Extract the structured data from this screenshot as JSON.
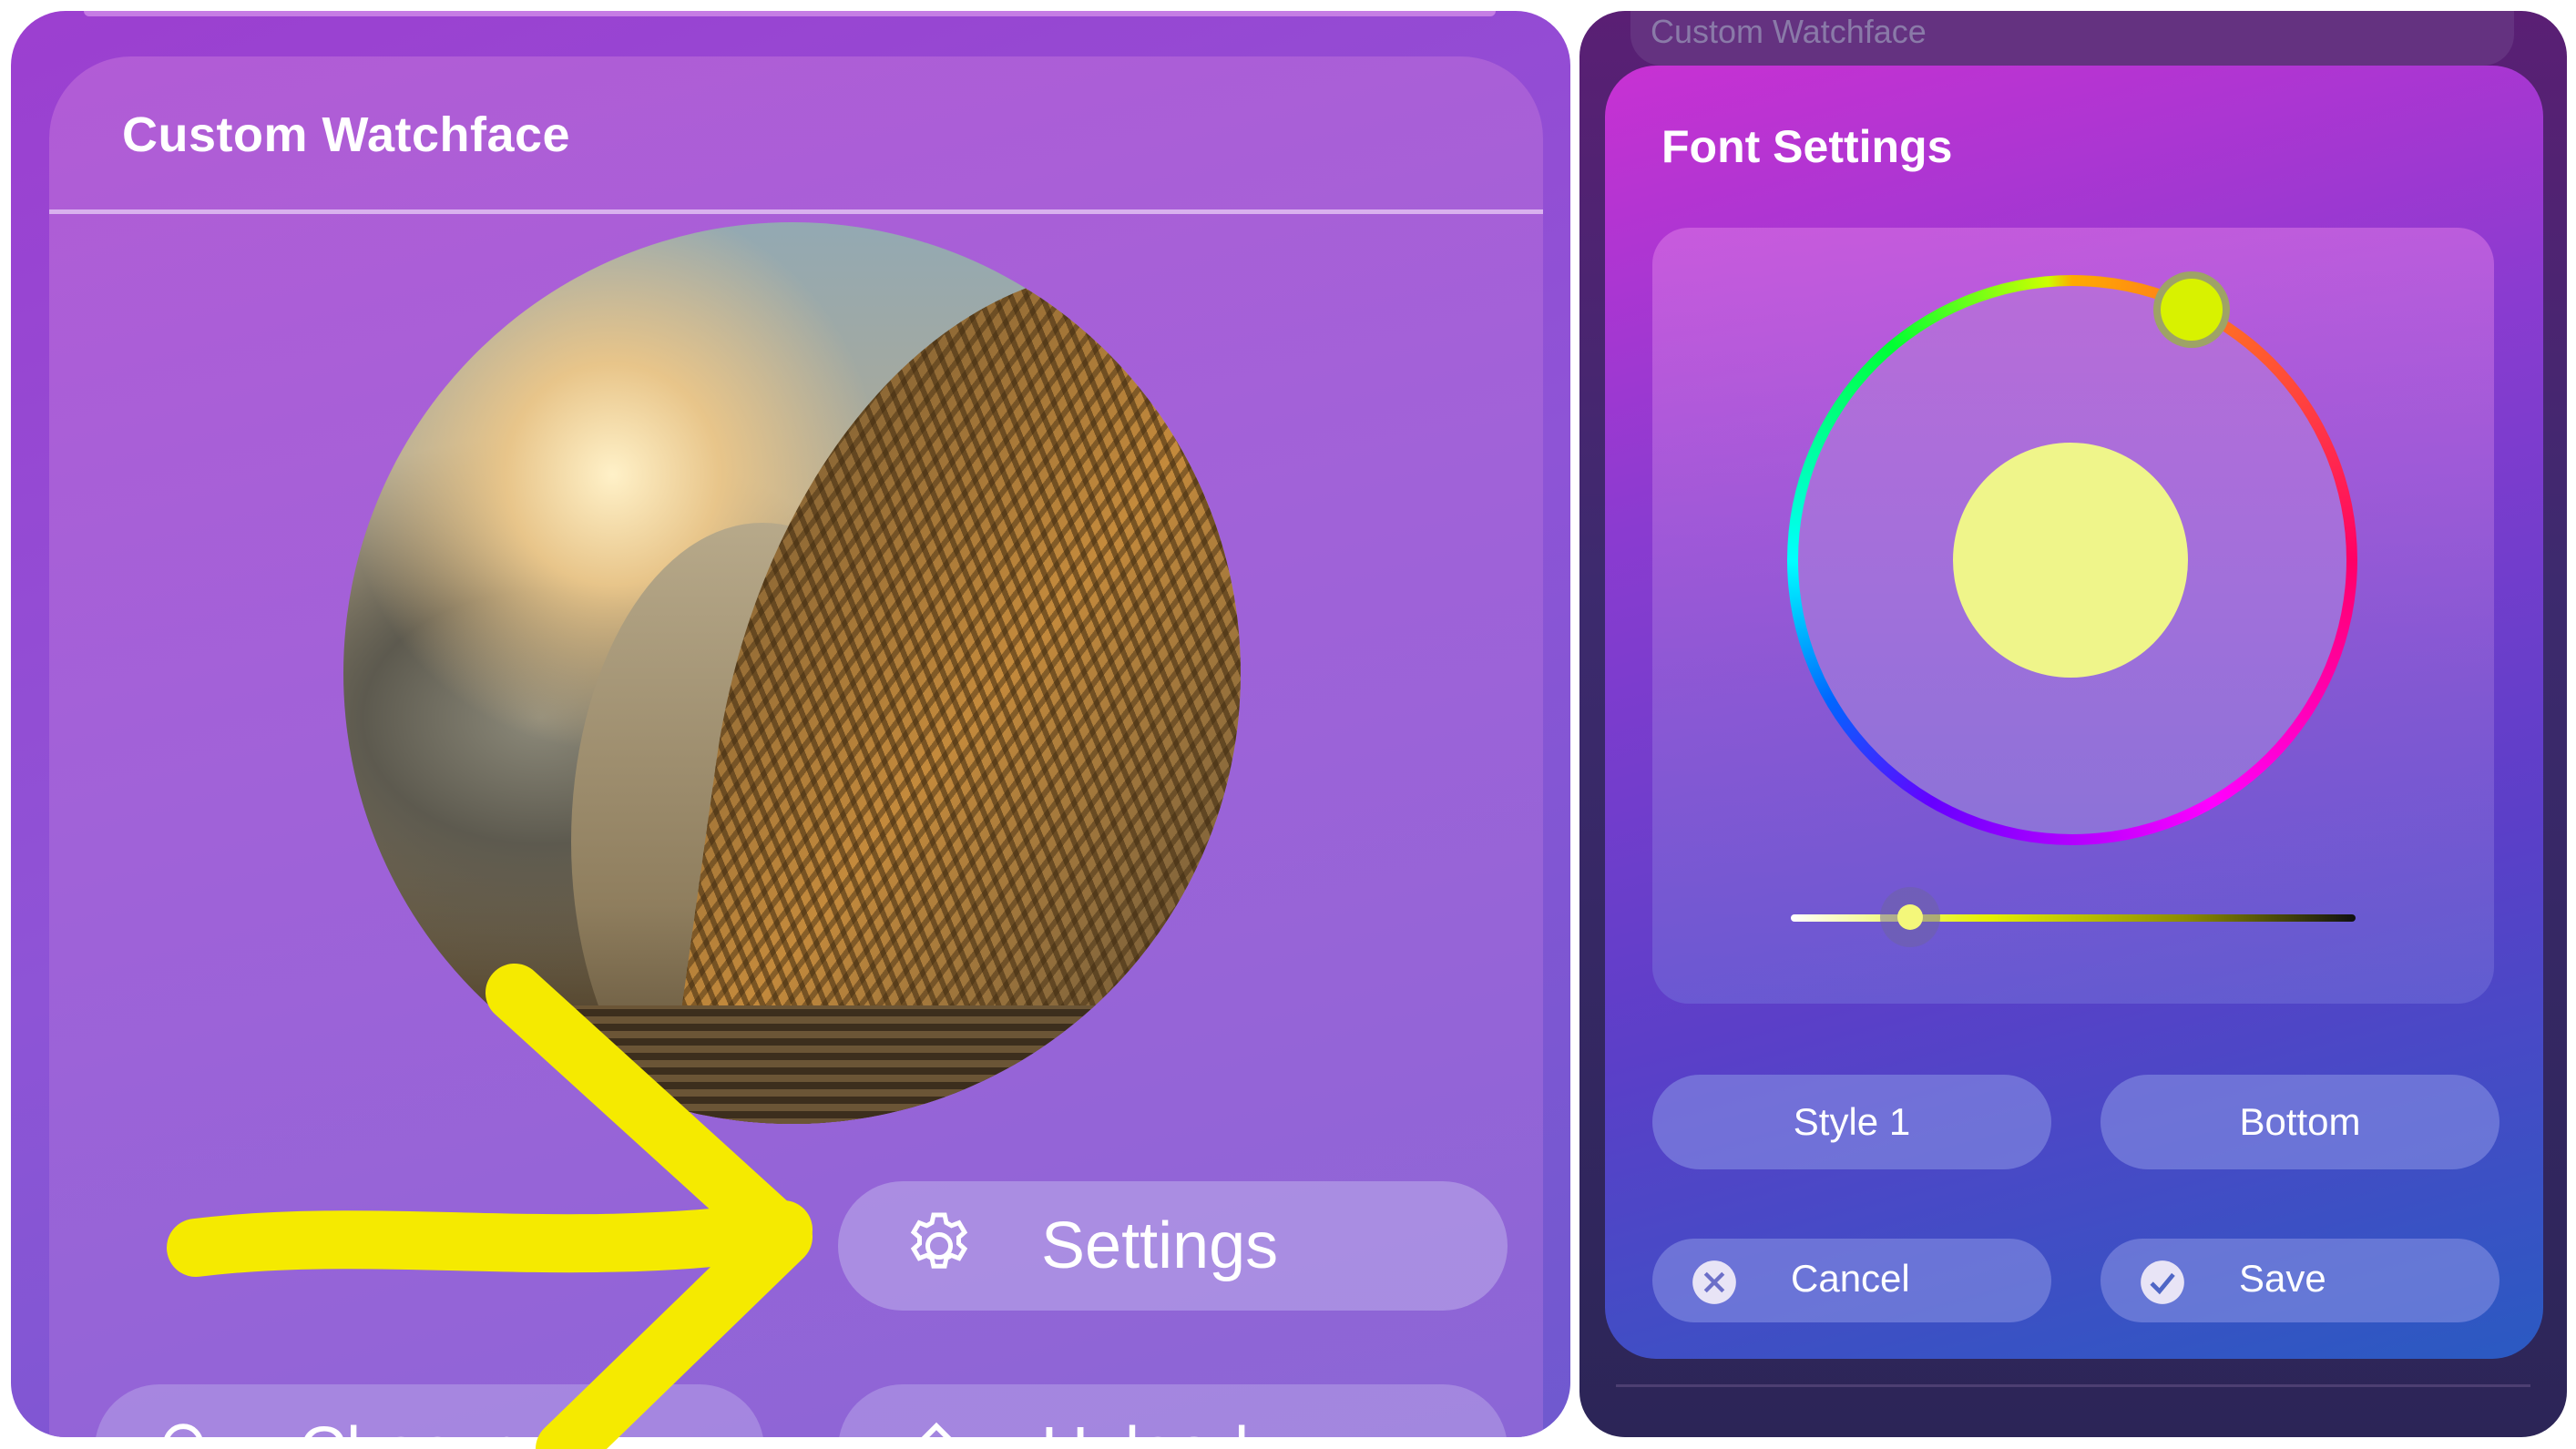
{
  "left": {
    "card_title": "Custom Watchface",
    "settings_label": "Settings",
    "choose_label": "Choose",
    "upload_label": "Upload"
  },
  "right": {
    "background_title": "Custom Watchface",
    "dialog_title": "Font Settings",
    "style_label": "Style 1",
    "position_label": "Bottom",
    "cancel_label": "Cancel",
    "save_label": "Save",
    "selected_color": "#eff58a",
    "wheel_handle_color": "#d8f200"
  },
  "colors": {
    "annotation": "#f5ea00",
    "panel_purple": "#9c3fd0"
  }
}
